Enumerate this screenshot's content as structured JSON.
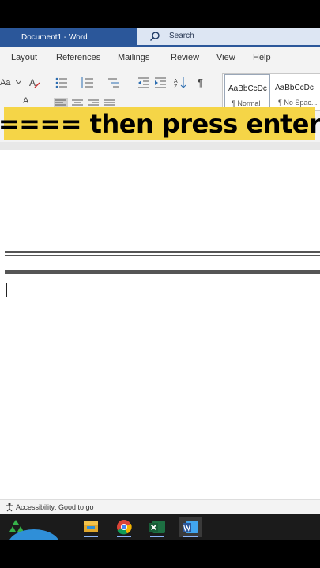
{
  "window": {
    "title": "Document1  -  Word",
    "search_label": "Search"
  },
  "ribbon_tabs": [
    "Layout",
    "References",
    "Mailings",
    "Review",
    "View",
    "Help"
  ],
  "toolbar": {
    "font_size_label": "Aa",
    "font_color_label": "A",
    "paragraph_mark": "¶"
  },
  "styles": [
    {
      "sample": "AaBbCcDc",
      "name": "¶ Normal"
    },
    {
      "sample": "AaBbCcDc",
      "name": "¶ No Spac..."
    }
  ],
  "caption": "==== then press enter",
  "status": {
    "accessibility": "Accessibility: Good to go"
  },
  "colors": {
    "title_bar": "#2b579a",
    "caption_bg": "#f5d547",
    "excel": "#1d6f42",
    "word": "#2b579a"
  }
}
